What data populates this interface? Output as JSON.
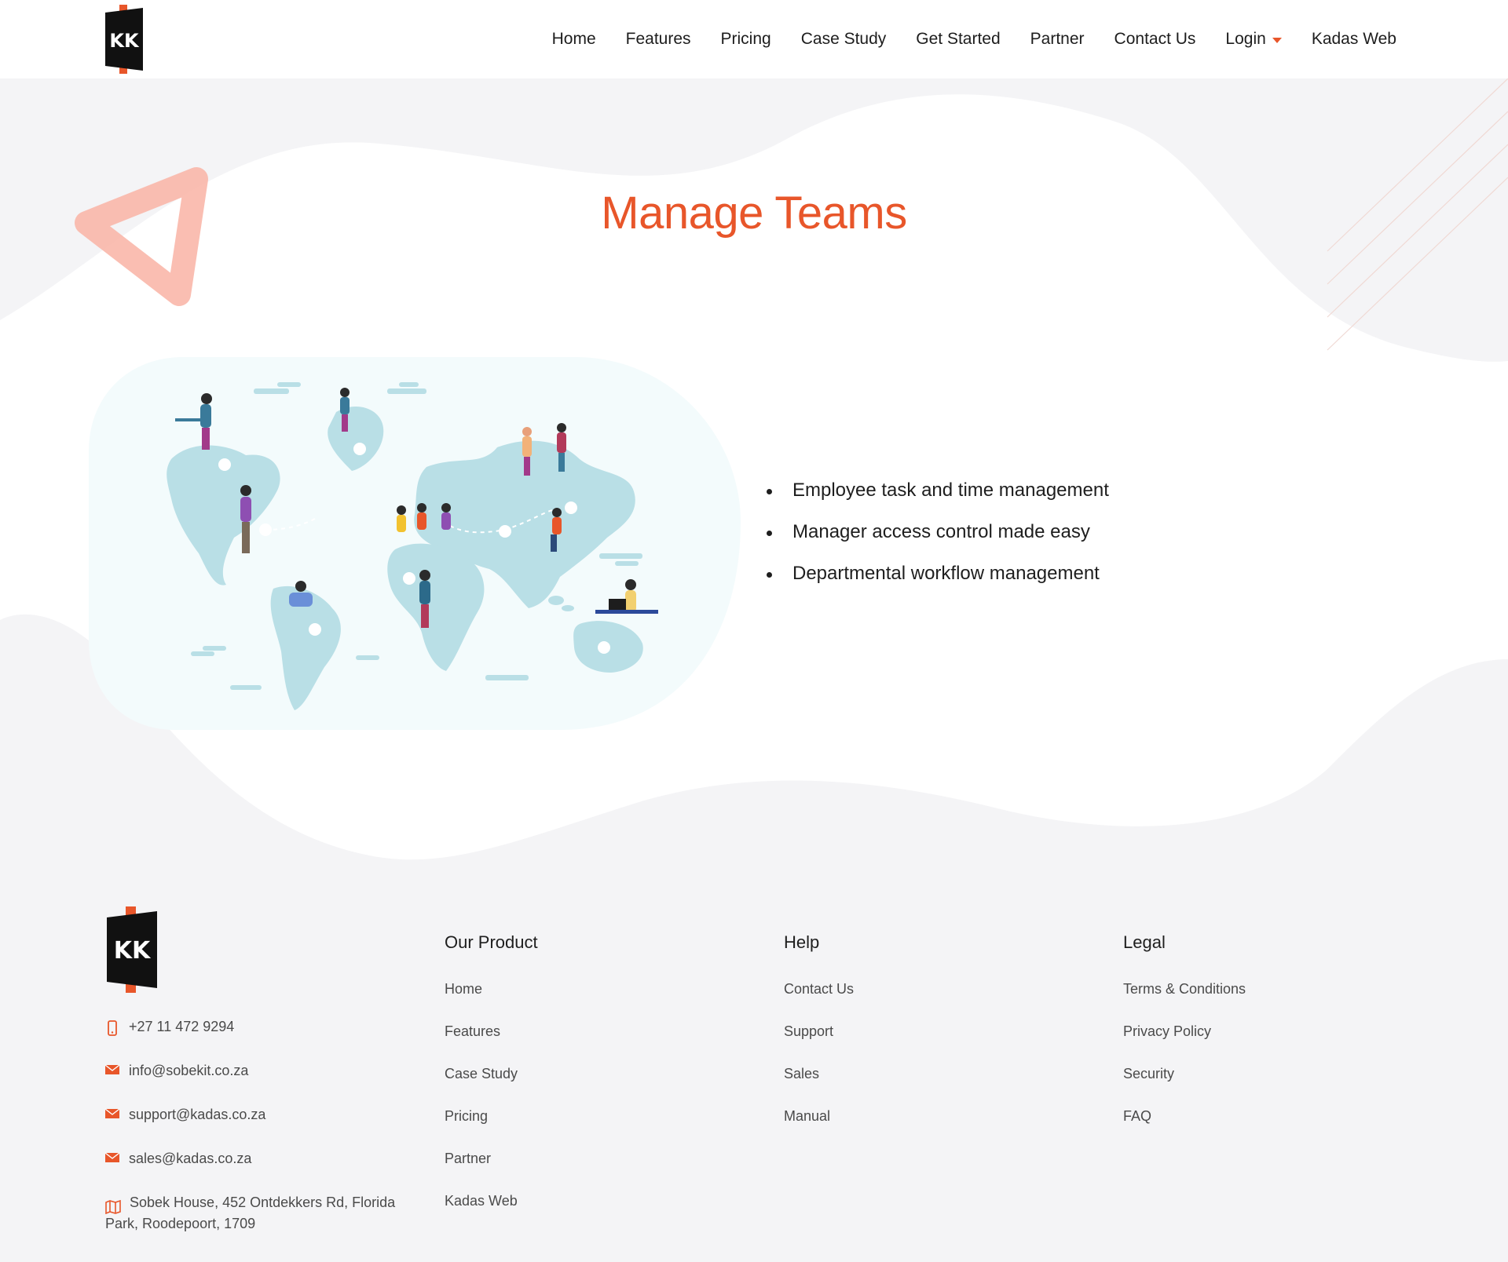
{
  "nav": {
    "items": [
      {
        "label": "Home"
      },
      {
        "label": "Features"
      },
      {
        "label": "Pricing"
      },
      {
        "label": "Case Study"
      },
      {
        "label": "Get Started"
      },
      {
        "label": "Partner"
      },
      {
        "label": "Contact Us"
      },
      {
        "label": "Login"
      },
      {
        "label": "Kadas Web"
      }
    ]
  },
  "hero": {
    "title": "Manage Teams"
  },
  "features": [
    "Employee task and time management",
    "Manager access control made easy",
    "Departmental workflow management"
  ],
  "footer": {
    "contact": {
      "phone": "+27 11 472 9294",
      "emails": [
        "info@sobekit.co.za",
        "support@kadas.co.za",
        "sales@kadas.co.za"
      ],
      "address": "Sobek House, 452 Ontdekkers Rd, Florida Park, Roodepoort, 1709"
    },
    "columns": [
      {
        "heading": "Our Product",
        "links": [
          "Home",
          "Features",
          "Case Study",
          "Pricing",
          "Partner",
          "Kadas Web"
        ]
      },
      {
        "heading": "Help",
        "links": [
          "Contact Us",
          "Support",
          "Sales",
          "Manual"
        ]
      },
      {
        "heading": "Legal",
        "links": [
          "Terms & Conditions",
          "Privacy Policy",
          "Security",
          "FAQ"
        ]
      }
    ]
  },
  "colors": {
    "accent": "#e8562a",
    "background": "#f4f4f6",
    "map": "#b9dfe6",
    "card": "#f3fbfc"
  },
  "icons": {
    "phone": "phone-icon",
    "email": "email-icon",
    "address": "map-icon"
  }
}
